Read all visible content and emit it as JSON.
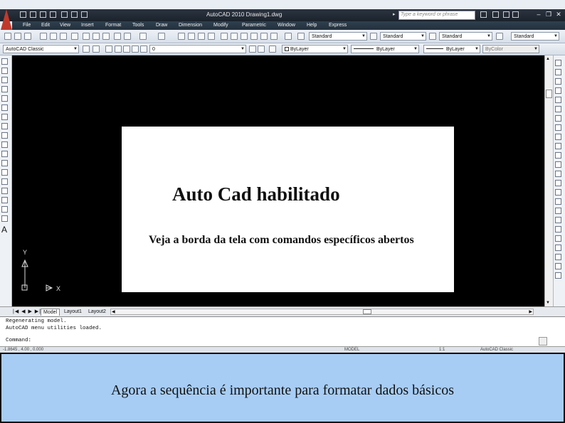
{
  "window": {
    "title": "AutoCAD 2010   Drawing1.dwg",
    "search_placeholder": "Type a keyword or phrase"
  },
  "menu": [
    "File",
    "Edit",
    "View",
    "Insert",
    "Format",
    "Tools",
    "Draw",
    "Dimension",
    "Modify",
    "Parametric",
    "Window",
    "Help",
    "Express"
  ],
  "toolbar": {
    "text_style": "Standard",
    "dim_style": "Standard",
    "table_style": "Standard",
    "multileader_style": "Standard",
    "workspace": "AutoCAD Classic",
    "layer": "0",
    "color": "ByLayer",
    "linetype": "ByLayer",
    "lineweight": "ByLayer",
    "plot_style": "ByColor"
  },
  "slide": {
    "heading": "Auto  Cad  habilitado",
    "subtext": "Veja a borda da tela com comandos específicos abertos"
  },
  "ucs": {
    "y": "Y",
    "x": "X"
  },
  "tabs": [
    "Model",
    "Layout1",
    "Layout2"
  ],
  "command_lines": [
    "Regenerating model.",
    "AutoCAD menu utilities loaded.",
    "Command:"
  ],
  "status": {
    "coords": "-1.8645 , 4.00 , 0.000",
    "model_label": "MODEL",
    "scale": "1:1",
    "workspace": "AutoCAD Classic"
  },
  "caption": "Agora a sequência é importante para formatar dados básicos"
}
